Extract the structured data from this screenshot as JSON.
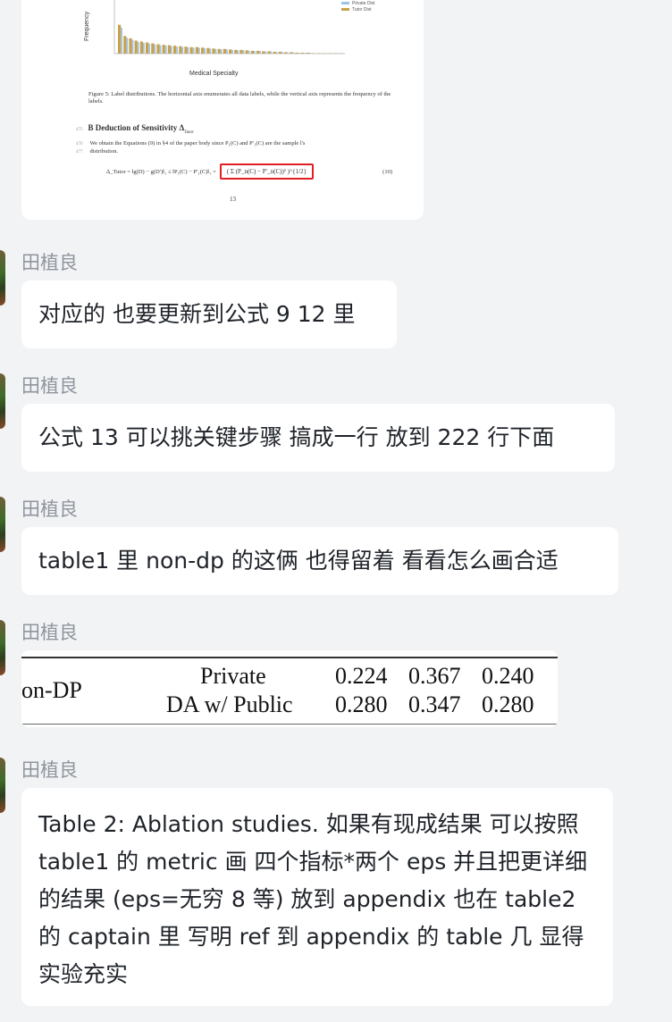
{
  "top_image": {
    "legend": [
      "Private Dist",
      "Tutor Dist"
    ],
    "ylabel": "Frequency",
    "xlabel": "Medical Specialty",
    "caption": "Figure 5: Label distributions. The horizontal axis enumerates all data labels, while the vertical axis represents the frequency of the labels.",
    "section_no": "475",
    "section_title": "B   Deduction of Sensitivity Δ",
    "section_sub": "Tutor",
    "para_line1_no": "476",
    "para_line1": "We obtain the Equations (9) in §4 of the paper body since P₁(C) and P′₁(C) are the sample l's",
    "para_line2_no": "477",
    "para_line2": "distribution.",
    "eq_left": "Δ_Tutor = ‖g(D) − g(D′)‖₂ ≤ ‖P₁(C) − P′₁(C)‖₂ =",
    "eq_box": "( Σ (P_n(C) − P′_n(C))² )^{1/2}",
    "eq_num": "(10)",
    "page_no": "13",
    "bar_values": [
      0.62,
      0.38,
      0.33,
      0.28,
      0.26,
      0.24,
      0.22,
      0.2,
      0.19,
      0.18,
      0.17,
      0.16,
      0.15,
      0.14,
      0.14,
      0.13,
      0.12,
      0.11,
      0.1,
      0.1,
      0.09,
      0.08,
      0.08,
      0.07,
      0.06,
      0.06,
      0.05,
      0.05,
      0.04,
      0.04,
      0.03,
      0.03,
      0.02,
      0.02,
      0.02,
      0.01,
      0.01,
      0.01,
      0.01,
      0.01,
      0.01
    ],
    "colors": {
      "private": "#9ec3e6",
      "tutor": "#c8a14a"
    }
  },
  "messages": [
    {
      "sender": "田植良",
      "text": "对应的 也要更新到公式 9 12 里"
    },
    {
      "sender": "田植良",
      "text": "公式 13 可以挑关键步骤 搞成一行 放到 222 行下面"
    },
    {
      "sender": "田植良",
      "text": "table1 里 non-dp 的这俩 也得留着 看看怎么画合适"
    },
    {
      "sender": "田植良"
    },
    {
      "sender": "田植良",
      "text": "Table 2: Ablation studies. 如果有现成结果 可以按照 table1 的 metric 画 四个指标*两个 eps 并且把更详细的结果 (eps=无穷 8 等) 放到 appendix 也在 table2 的 captain 里 写明 ref 到 appendix 的 table 几 显得实验充实"
    }
  ],
  "table_snippet": {
    "group": "on-DP",
    "rows": [
      {
        "method": "Private",
        "values": [
          "0.224",
          "0.367",
          "0.240"
        ]
      },
      {
        "method": "DA w/ Public",
        "values": [
          "0.280",
          "0.347",
          "0.280"
        ]
      }
    ]
  }
}
